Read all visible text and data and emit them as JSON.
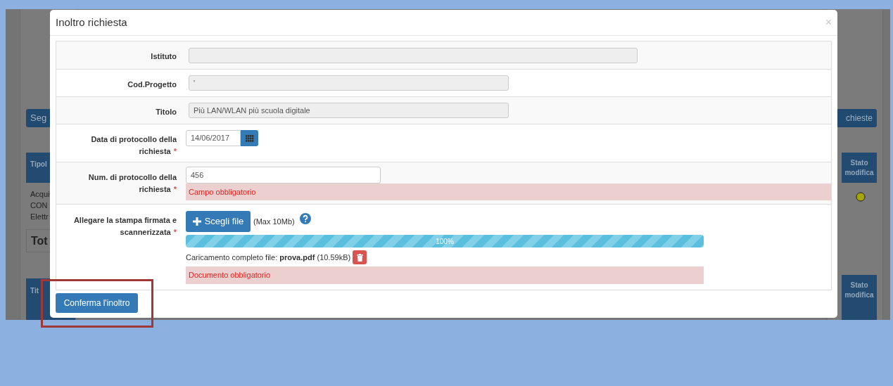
{
  "background": {
    "left": {
      "button": "Seg",
      "header": "Tipol",
      "rows": [
        "Acqui",
        "CON",
        "Elettr"
      ],
      "total": "Tot",
      "header_2": "Tit"
    },
    "right": {
      "button": "chieste",
      "header": "Stato modifica",
      "header_2": "Stato modifica"
    }
  },
  "modal": {
    "title": "Inoltro richiesta",
    "close": "×",
    "fields": [
      {
        "kind": "readonly_wide",
        "label": "Istituto"
      },
      {
        "kind": "readonly",
        "label": "Cod.Progetto",
        "value": "'"
      },
      {
        "kind": "readonly",
        "label": "Titolo",
        "value": "Più LAN/WLAN più scuola digitale"
      },
      {
        "kind": "date",
        "label": "Data di protocollo della richiesta",
        "required_mark": "*",
        "value": "14/06/2017"
      },
      {
        "kind": "text",
        "label": "Num. di protocollo della richiesta",
        "required_mark": "*",
        "value": "456",
        "error": "Campo obbligatorio"
      },
      {
        "kind": "upload",
        "label": "Allegare la stampa firmata e scannerizzata",
        "required_mark": "*",
        "button": "Scegli file",
        "hint": "(Max 10Mb)",
        "progress": {
          "level": 1,
          "label": "100%"
        },
        "status": "Caricamento completo file: **prova.pdf** (10.59kB)",
        "error": "Documento obbligatorio"
      }
    ],
    "confirm_button": "Conferma l'inoltro"
  }
}
